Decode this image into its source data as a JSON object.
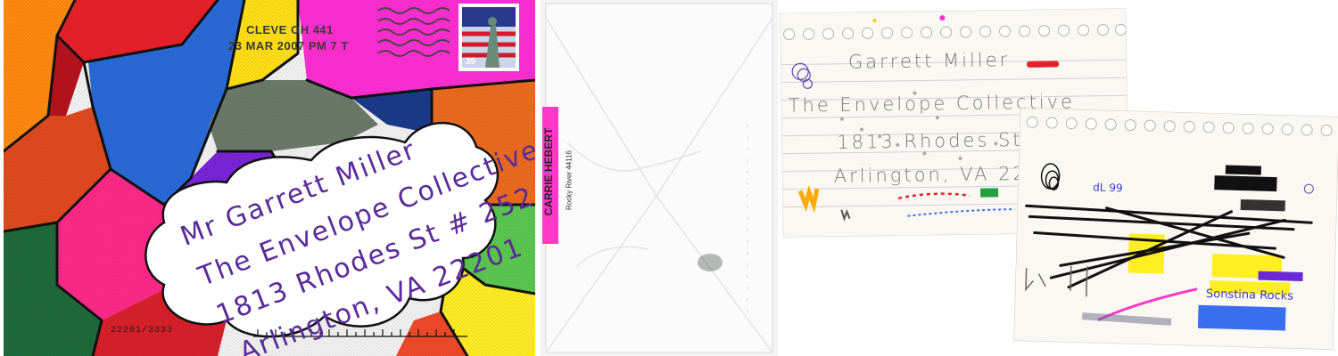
{
  "envelope_front": {
    "postmark_city": "CLEVE OH 441",
    "postmark_date": "23 MAR 2007 PM 7 T",
    "stamp_denomination": "39",
    "address": {
      "line1": "Mr Garrett Miller",
      "line2": "The Envelope Collective",
      "line3": "1813 Rhodes St # 252",
      "line4": "Arlington, VA 22201"
    },
    "barcode_text": "22201/3333"
  },
  "envelope_back": {
    "sender_label": "CARRIE HEBERT",
    "sender_sub": "Rocky River 44116"
  },
  "card_front": {
    "line1": "Garrett Miller",
    "line2": "The Envelope Collective",
    "line3": "1813 Rhodes St #25",
    "line4": "Arlington, VA 22201"
  },
  "card_back": {
    "note": "Sonstina Rocks",
    "blue_marks": "dL 99"
  },
  "colors": {
    "address_ink": "#5a2a9a",
    "pink_label": "#ff38c8",
    "marker_yellow": "#ffee22",
    "marker_blue": "#3a6ef0"
  }
}
